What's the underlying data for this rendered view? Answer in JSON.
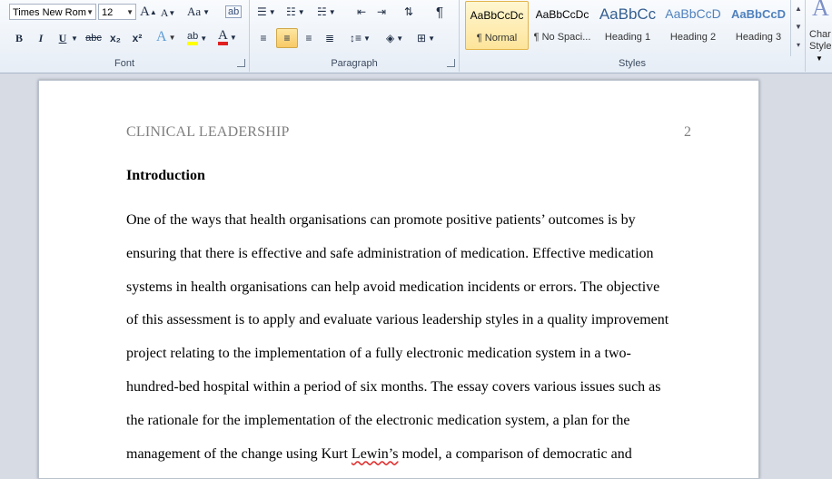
{
  "ribbon": {
    "font": {
      "label": "Font",
      "name": "Times New Rom",
      "size": "12",
      "grow_label": "A",
      "shrink_label": "A",
      "case_label": "Aa",
      "bold": "B",
      "italic": "I",
      "underline": "U",
      "strike": "abc",
      "subscript": "x₂",
      "superscript": "x²",
      "effects": "A",
      "highlight": "ab",
      "font_color": "A"
    },
    "paragraph": {
      "label": "Paragraph",
      "pilcrow": "¶"
    },
    "styles": {
      "label": "Styles",
      "items": [
        {
          "sample": "AaBbCcDc",
          "name": "¶ Normal"
        },
        {
          "sample": "AaBbCcDc",
          "name": "¶ No Spaci..."
        },
        {
          "sample": "AaBbCc",
          "name": "Heading 1"
        },
        {
          "sample": "AaBbCcD",
          "name": "Heading 2"
        },
        {
          "sample": "AaBbCcD",
          "name": "Heading 3"
        }
      ]
    },
    "change_styles": {
      "glyph": "A",
      "label1": "Char",
      "label2": "Style"
    }
  },
  "document": {
    "header": "CLINICAL LEADERSHIP",
    "page_number": "2",
    "heading": "Introduction",
    "lines": [
      "One of the ways that health organisations can promote positive patients’ outcomes is by",
      "ensuring that there is effective and safe administration of medication. Effective medication",
      "systems in health organisations can help avoid medication incidents or errors. The objective",
      "of this assessment is to apply and evaluate various leadership styles in a quality improvement",
      "project relating to the implementation of a fully electronic medication system in a two-",
      "hundred-bed hospital within a period of six months. The essay covers various issues such as",
      "the rationale for the implementation of the electronic medication system, a plan for the"
    ],
    "last_line": {
      "before": "management of the change using Kurt ",
      "flagged": "Lewin’s",
      "after": " model, a comparison of democratic and"
    }
  }
}
